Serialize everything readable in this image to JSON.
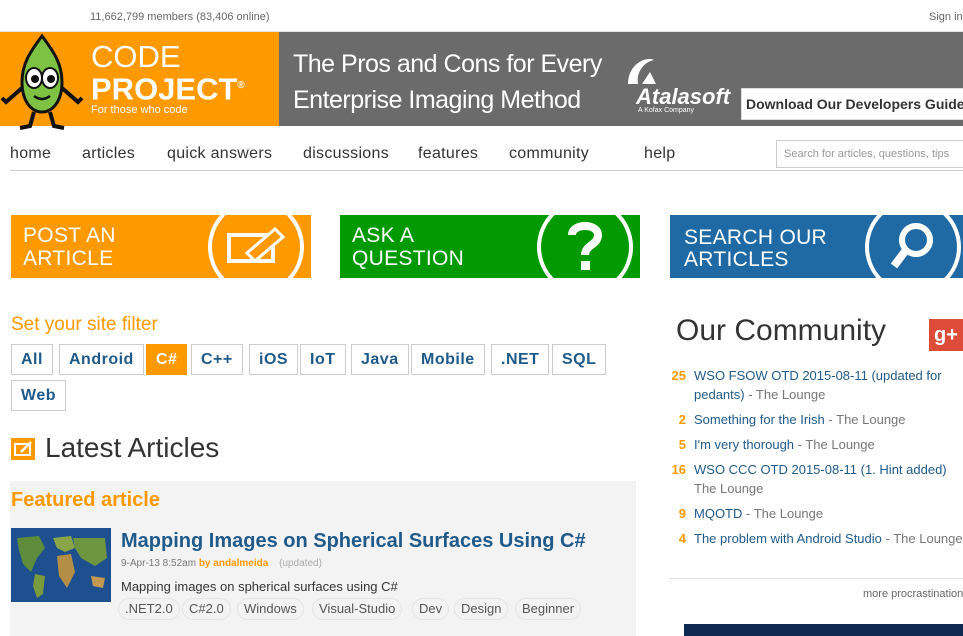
{
  "topbar": {
    "members": "11,662,799 members (83,406 online)",
    "signin": "Sign in"
  },
  "logo": {
    "code": "CODE",
    "project": "PROJECT",
    "reg": "®",
    "tagline": "For those who code"
  },
  "ad": {
    "title": "The Pros and Cons for Every Enterprise Imaging Method",
    "brand": "Atalasoft",
    "brand_sub": "A Kofax Company",
    "cta": "Download Our Developers Guide"
  },
  "nav": {
    "items": [
      "home",
      "articles",
      "quick answers",
      "discussions",
      "features",
      "community",
      "help"
    ],
    "search_placeholder": "Search for articles, questions, tips"
  },
  "cta": {
    "post": "POST AN ARTICLE",
    "ask": "ASK A QUESTION",
    "search": "SEARCH OUR ARTICLES"
  },
  "filter": {
    "title": "Set your site filter",
    "chips": [
      "All",
      "Android",
      "C#",
      "C++",
      "iOS",
      "IoT",
      "Java",
      "Mobile",
      ".NET",
      "SQL",
      "Web"
    ],
    "active": "C#"
  },
  "latest": {
    "title": "Latest Articles",
    "featured_label": "Featured article",
    "article": {
      "title": "Mapping Images on Spherical Surfaces Using C#",
      "date": "9-Apr-13 8:52am",
      "by": "by",
      "author": "andalmeida",
      "updated": "(updated)",
      "description": "Mapping images on spherical surfaces using C#",
      "tags": [
        ".NET2.0",
        "C#2.0",
        "Windows",
        "Visual-Studio",
        "Dev",
        "Design",
        "Beginner"
      ]
    }
  },
  "community": {
    "title": "Our Community",
    "gplus": "g+",
    "items": [
      {
        "count": "25",
        "title": "WSO FSOW OTD 2015-08-11 (updated for",
        "title2": "pedants)",
        "forum": "The Lounge"
      },
      {
        "count": "2",
        "title": "Something for the Irish",
        "forum": "The Lounge"
      },
      {
        "count": "5",
        "title": "I'm very thorough",
        "forum": "The Lounge"
      },
      {
        "count": "16",
        "title": "WSO CCC OTD 2015-08-11 (1. Hint added)",
        "title2": "",
        "forum": "The Lounge"
      },
      {
        "count": "9",
        "title": "MQOTD",
        "forum": "The Lounge"
      },
      {
        "count": "4",
        "title": "The problem with Android Studio",
        "forum": "The Lounge"
      }
    ],
    "separator": " - ",
    "more": "more procrastination"
  },
  "colors": {
    "orange": "#ff9900",
    "green": "#009900",
    "blue": "#1f6aa5",
    "link": "#1f5a8a"
  }
}
